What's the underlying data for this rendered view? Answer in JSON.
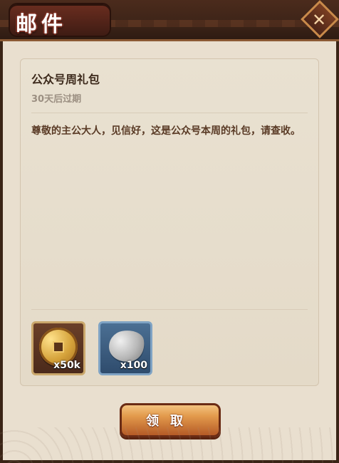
{
  "window": {
    "title": "邮件"
  },
  "mail": {
    "subject": "公众号周礼包",
    "expire": "30天后过期",
    "body": "尊敬的主公大人，见信好，这是公众号本周的礼包，请查收。",
    "attachments": [
      {
        "name": "copper-coin",
        "qty": "x50k"
      },
      {
        "name": "stone",
        "qty": "x100"
      }
    ],
    "claim_label": "领取"
  },
  "icons": {
    "close": "close-icon",
    "coin": "copper-coin-icon",
    "stone": "stone-icon"
  },
  "colors": {
    "header": "#3d2418",
    "panel": "#e6dccb",
    "button": "#d98a44"
  }
}
